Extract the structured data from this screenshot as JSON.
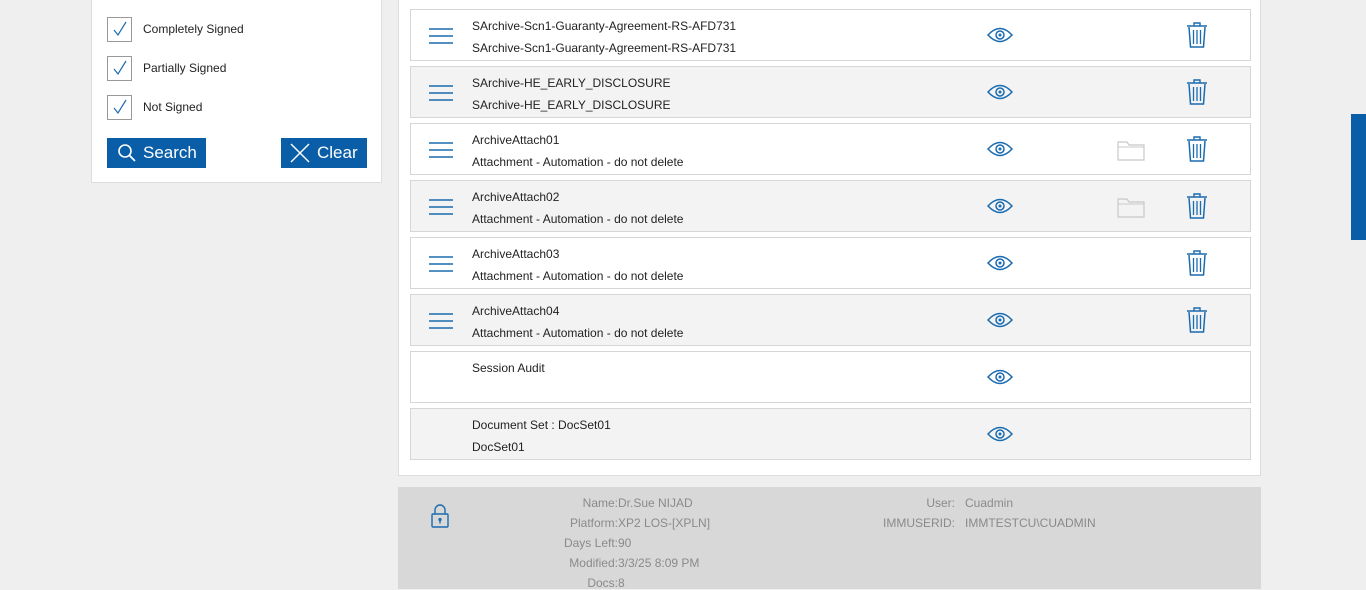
{
  "filters": {
    "items": [
      {
        "label": "Completely Signed",
        "checked": true
      },
      {
        "label": "Partially Signed",
        "checked": true
      },
      {
        "label": "Not Signed",
        "checked": true
      }
    ],
    "search_label": "Search",
    "clear_label": "Clear"
  },
  "documents": [
    {
      "title": "SArchive-Scn1-Guaranty-Agreement-RS-AFD731",
      "subtitle": "SArchive-Scn1-Guaranty-Agreement-RS-AFD731",
      "menu": true,
      "folder": false,
      "trash": true
    },
    {
      "title": "SArchive-HE_EARLY_DISCLOSURE",
      "subtitle": "SArchive-HE_EARLY_DISCLOSURE",
      "menu": true,
      "folder": false,
      "trash": true
    },
    {
      "title": "ArchiveAttach01",
      "subtitle": "Attachment - Automation - do not delete",
      "menu": true,
      "folder": true,
      "trash": true
    },
    {
      "title": "ArchiveAttach02",
      "subtitle": "Attachment - Automation - do not delete",
      "menu": true,
      "folder": true,
      "trash": true
    },
    {
      "title": "ArchiveAttach03",
      "subtitle": "Attachment - Automation - do not delete",
      "menu": true,
      "folder": false,
      "trash": true
    },
    {
      "title": "ArchiveAttach04",
      "subtitle": "Attachment - Automation - do not delete",
      "menu": true,
      "folder": false,
      "trash": true
    },
    {
      "title": "Session Audit",
      "subtitle": "",
      "menu": false,
      "folder": false,
      "trash": false
    },
    {
      "title": "Document Set : DocSet01",
      "subtitle": "DocSet01",
      "menu": false,
      "folder": false,
      "trash": false
    }
  ],
  "info": {
    "name_label": "Name:",
    "name_value": "Dr.Sue NIJAD",
    "platform_label": "Platform:",
    "platform_value": "XP2 LOS-[XPLN]",
    "days_left_label": "Days Left:",
    "days_left_value": "90",
    "modified_label": "Modified:",
    "modified_value": "3/3/25 8:09 PM",
    "docs_label": "Docs:",
    "docs_value": "8",
    "user_label": "User:",
    "user_value": "Cuadmin",
    "immuserid_label": "IMMUSERID:",
    "immuserid_value": "IMMTESTCU\\CUADMIN"
  },
  "colors": {
    "accent": "#0a5ea8",
    "icon_blue": "#1a6bb0",
    "row_alt": "#f3f3f3",
    "footer_bg": "#d8d8d8"
  }
}
